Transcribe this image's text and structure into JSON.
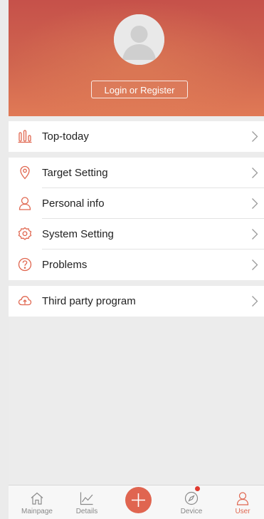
{
  "header": {
    "login_label": "Login or Register"
  },
  "menu": {
    "group1": [
      {
        "label": "Top-today",
        "icon": "bar-chart-icon"
      }
    ],
    "group2": [
      {
        "label": "Target Setting",
        "icon": "location-pin-icon"
      },
      {
        "label": "Personal info",
        "icon": "person-icon"
      },
      {
        "label": "System Setting",
        "icon": "gear-icon"
      },
      {
        "label": "Problems",
        "icon": "question-icon"
      }
    ],
    "group3": [
      {
        "label": "Third party program",
        "icon": "cloud-upload-icon"
      }
    ]
  },
  "tabbar": {
    "items": [
      {
        "label": "Mainpage",
        "icon": "home-icon"
      },
      {
        "label": "Details",
        "icon": "line-chart-icon"
      },
      {
        "label": "",
        "icon": "plus-icon"
      },
      {
        "label": "Device",
        "icon": "compass-icon",
        "badge": true
      },
      {
        "label": "User",
        "icon": "person-icon",
        "active": true
      }
    ]
  },
  "colors": {
    "accent": "#e0664f",
    "header_top": "#c6514a",
    "header_bottom": "#e07a56",
    "badge": "#e03a2f"
  }
}
